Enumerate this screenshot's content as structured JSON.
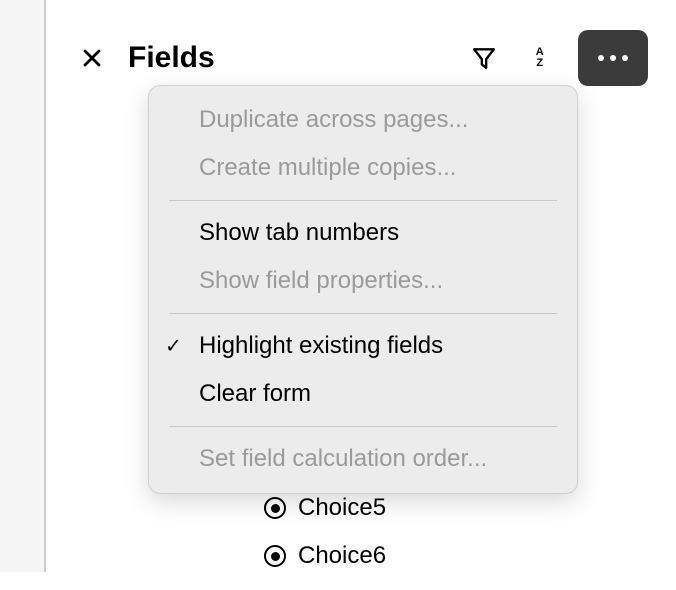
{
  "panel": {
    "title": "Fields"
  },
  "fields": {
    "items": [
      {
        "label": "Choice5"
      },
      {
        "label": "Choice6"
      }
    ]
  },
  "menu": {
    "duplicate": "Duplicate across pages...",
    "create_copies": "Create multiple copies...",
    "show_tab_numbers": "Show tab numbers",
    "show_field_props": "Show field properties...",
    "highlight": "Highlight existing fields",
    "clear_form": "Clear form",
    "calc_order": "Set field calculation order..."
  }
}
